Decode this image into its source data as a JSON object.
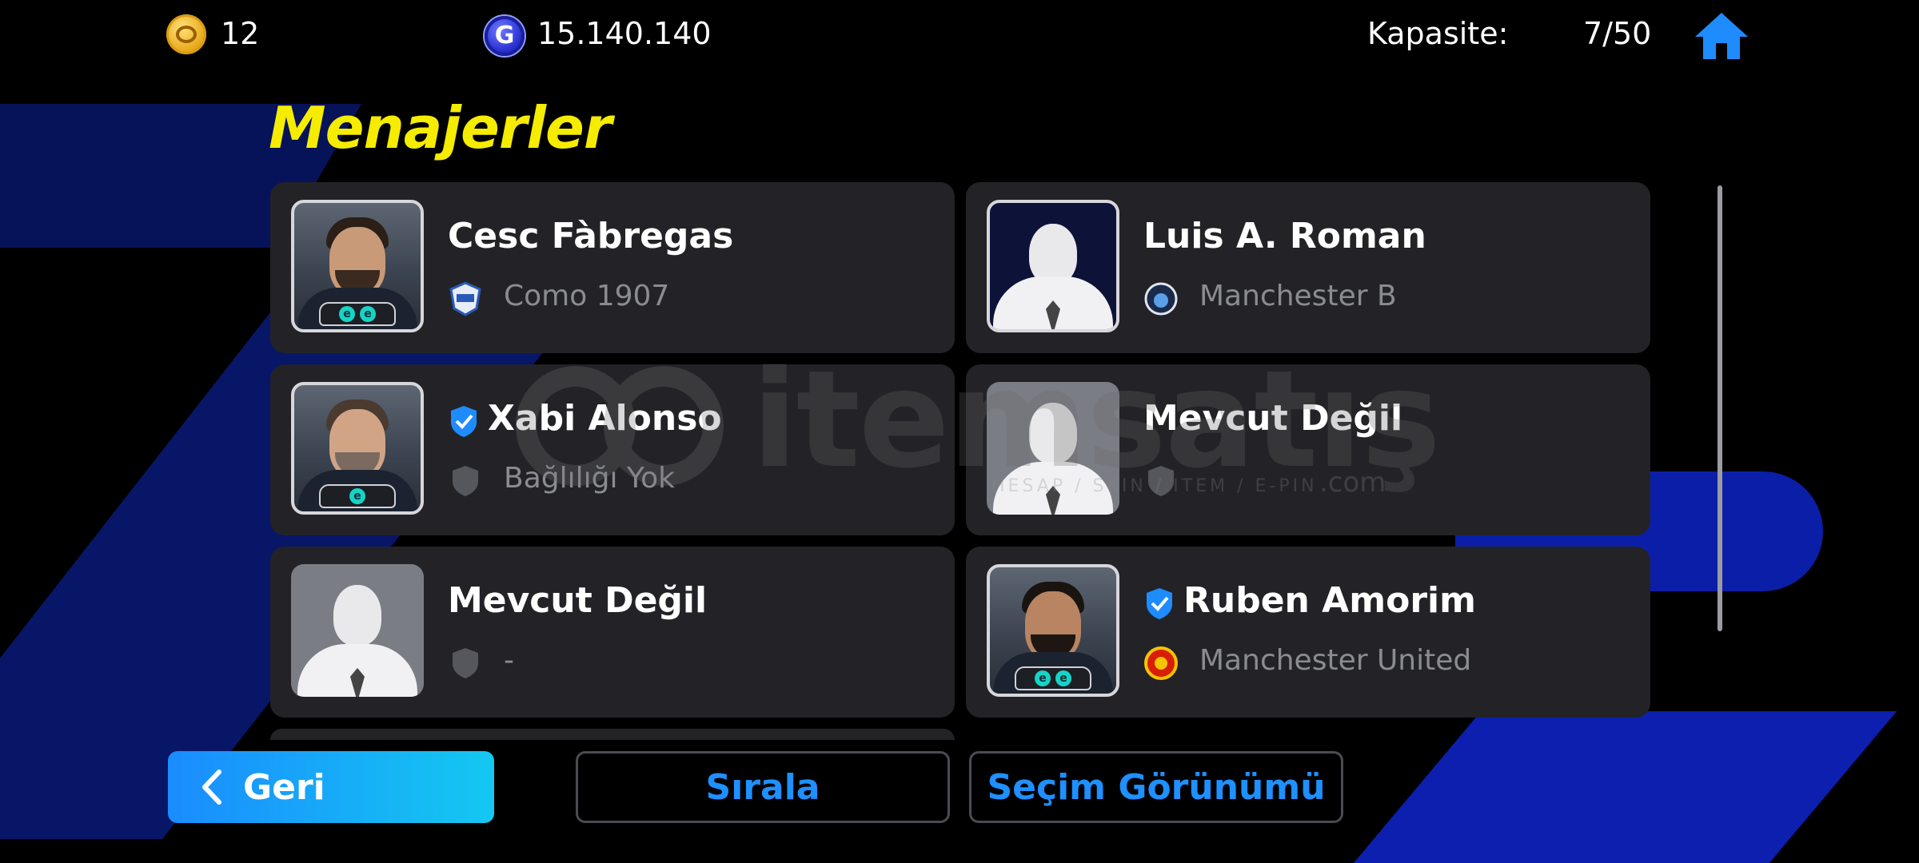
{
  "topbar": {
    "coins": "12",
    "gp": "15.140.140",
    "gp_symbol": "G",
    "capacity_label": "Kapasite:",
    "capacity_value": "7/50"
  },
  "page_title": "Menajerler",
  "managers": [
    {
      "name": "Cesc Fàbregas",
      "team": "Como 1907",
      "verified": false,
      "photo": "real",
      "badges": [
        "e",
        "e"
      ]
    },
    {
      "name": "Luis A. Roman",
      "team": "Manchester B",
      "verified": false,
      "photo": "silhouette",
      "badges": []
    },
    {
      "name": "Xabi Alonso",
      "team": "Bağlılığı Yok",
      "verified": true,
      "photo": "real",
      "badges": [
        "e"
      ]
    },
    {
      "name": "Mevcut Değil",
      "team": "",
      "verified": false,
      "photo": "silhouette",
      "badges": []
    },
    {
      "name": "Mevcut Değil",
      "team": "-",
      "verified": false,
      "photo": "silhouette",
      "badges": []
    },
    {
      "name": "Ruben Amorim",
      "team": "Manchester United",
      "verified": true,
      "photo": "real",
      "badges": [
        "e",
        "e"
      ]
    }
  ],
  "buttons": {
    "back": "Geri",
    "sort": "Sırala",
    "view": "Seçim Görünümü"
  },
  "watermark": {
    "text": "itemsatış",
    "sub": "HESAP / SKIN / ITEM / E-PIN",
    "com": ".com"
  },
  "colors": {
    "title": "#f5ec00",
    "accent_blue": "#1e90ff",
    "card": "#232327"
  }
}
